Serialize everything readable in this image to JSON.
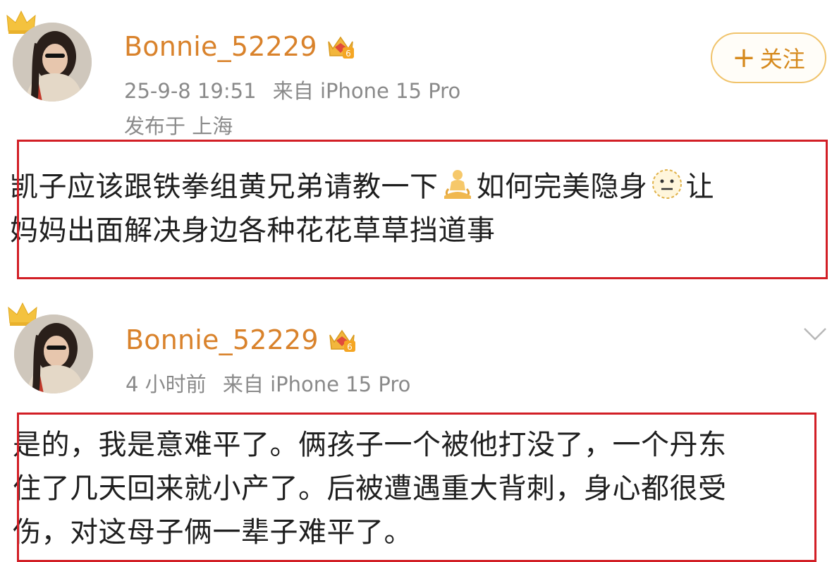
{
  "posts": [
    {
      "username": "Bonnie_52229",
      "time": "25-9-8 19:51",
      "source": "来自 iPhone 15 Pro",
      "location": "发布于 上海",
      "follow_label": "关注",
      "content": {
        "line1_a": "凯子应该跟铁拳组黄兄弟请教一下",
        "line1_b": "如何完美隐身",
        "line1_c": "让",
        "line2": "妈妈出面解决身边各种花花草草挡道事"
      },
      "emojis": [
        "meditation-icon",
        "neutral-face-icon"
      ]
    },
    {
      "username": "Bonnie_52229",
      "time": "4 小时前",
      "source": "来自 iPhone 15 Pro",
      "content": {
        "line1": "是的，我是意难平了。俩孩子一个被他打没了，一个丹东",
        "line2": "住了几天回来就小产了。后被遭遇重大背刺，身心都很受",
        "line3": "伤，对这母子俩一辈子难平了。"
      }
    }
  ],
  "colors": {
    "username": "#d9822b",
    "meta": "#8a8a8a",
    "highlight": "#d21f26",
    "follow": "#d68a1e"
  }
}
